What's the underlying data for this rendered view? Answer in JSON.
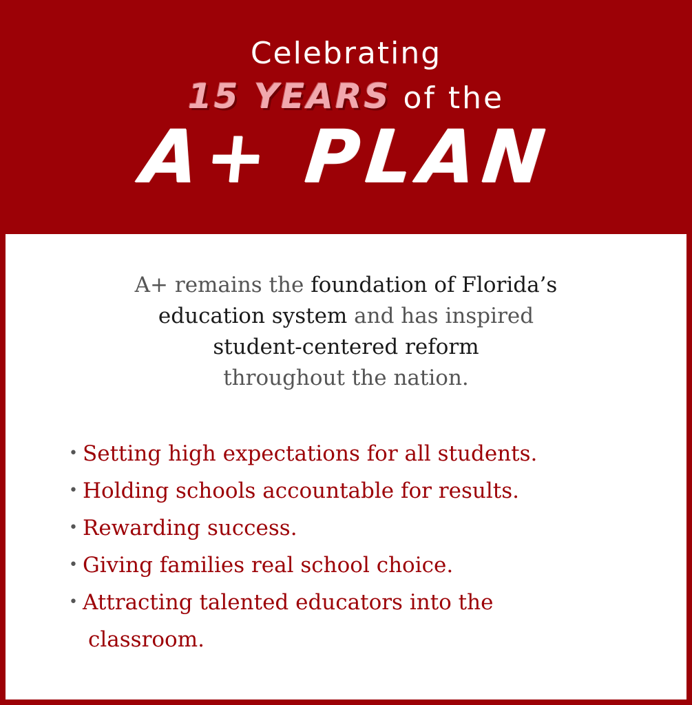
{
  "header": {
    "line1": "Celebrating",
    "highlight": "15 YEARS",
    "line2_rest": "of the",
    "plan": "A+ PLAN"
  },
  "intro": {
    "segment1": "A+ remains the ",
    "segment2": "foundation of Florida’s",
    "segment3": "education system",
    "segment4": " and has inspired",
    "segment5": "student-centered reform",
    "segment6": "throughout the nation."
  },
  "bullets": [
    {
      "text": "Setting high expectations for all students."
    },
    {
      "text": "Holding schools accountable for results."
    },
    {
      "text": "Rewarding success."
    },
    {
      "text": "Giving families real school choice."
    },
    {
      "text": "Attracting talented educators into the",
      "continuation": "classroom."
    }
  ],
  "bullet_glyph": "•",
  "colors": {
    "brand_red": "#9c0106",
    "highlight_pink": "#f1a8ae",
    "panel_white": "#ffffff",
    "text_gray": "#555555",
    "text_dark": "#1a1a1a"
  }
}
